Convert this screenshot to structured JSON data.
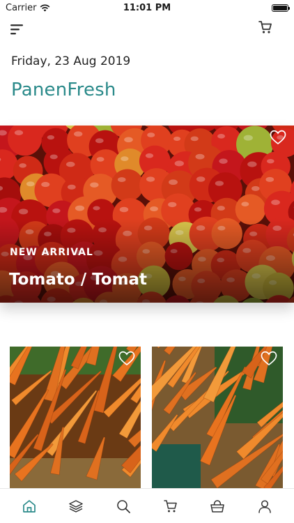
{
  "status_bar": {
    "carrier": "Carrier",
    "time": "11:01 PM"
  },
  "header": {
    "menu_icon": "menu-icon",
    "cart_icon": "cart-icon"
  },
  "date": "Friday, 23 Aug 2019",
  "brand": {
    "name": "PanenFresh",
    "color": "#2a8a8a"
  },
  "hero": {
    "tag": "NEW ARRIVAL",
    "title": "Tomato / Tomat",
    "icon": "heart-icon"
  },
  "products": [
    {
      "name": "carrot",
      "icon": "heart-icon"
    },
    {
      "name": "carrot",
      "icon": "heart-icon"
    }
  ],
  "bottom_nav": {
    "items": [
      "home-icon",
      "layers-icon",
      "search-icon",
      "cart-icon",
      "basket-icon",
      "user-icon"
    ],
    "active_color": "#2a8a8a"
  }
}
